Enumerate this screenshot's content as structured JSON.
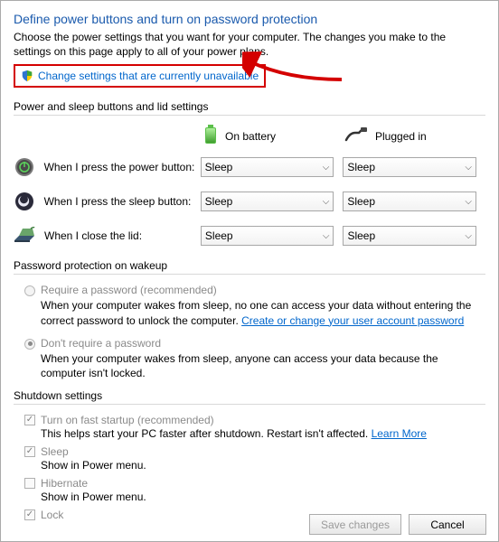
{
  "title": "Define power buttons and turn on password protection",
  "subtitle": "Choose the power settings that you want for your computer. The changes you make to the settings on this page apply to all of your power plans.",
  "change_link": "Change settings that are currently unavailable",
  "section1": {
    "header": "Power and sleep buttons and lid settings",
    "col_battery": "On battery",
    "col_plugged": "Plugged in",
    "rows": [
      {
        "label": "When I press the power button:",
        "battery": "Sleep",
        "plugged": "Sleep"
      },
      {
        "label": "When I press the sleep button:",
        "battery": "Sleep",
        "plugged": "Sleep"
      },
      {
        "label": "When I close the lid:",
        "battery": "Sleep",
        "plugged": "Sleep"
      }
    ]
  },
  "section2": {
    "header": "Password protection on wakeup",
    "opt1_label": "Require a password (recommended)",
    "opt1_desc_a": "When your computer wakes from sleep, no one can access your data without entering the correct password to unlock the computer. ",
    "opt1_link": "Create or change your user account password",
    "opt2_label": "Don't require a password",
    "opt2_desc": "When your computer wakes from sleep, anyone can access your data because the computer isn't locked."
  },
  "section3": {
    "header": "Shutdown settings",
    "fast_label": "Turn on fast startup (recommended)",
    "fast_desc_a": "This helps start your PC faster after shutdown. Restart isn't affected. ",
    "fast_link": "Learn More",
    "sleep_label": "Sleep",
    "sleep_desc": "Show in Power menu.",
    "hibernate_label": "Hibernate",
    "hibernate_desc": "Show in Power menu.",
    "lock_label": "Lock"
  },
  "buttons": {
    "save": "Save changes",
    "cancel": "Cancel"
  }
}
